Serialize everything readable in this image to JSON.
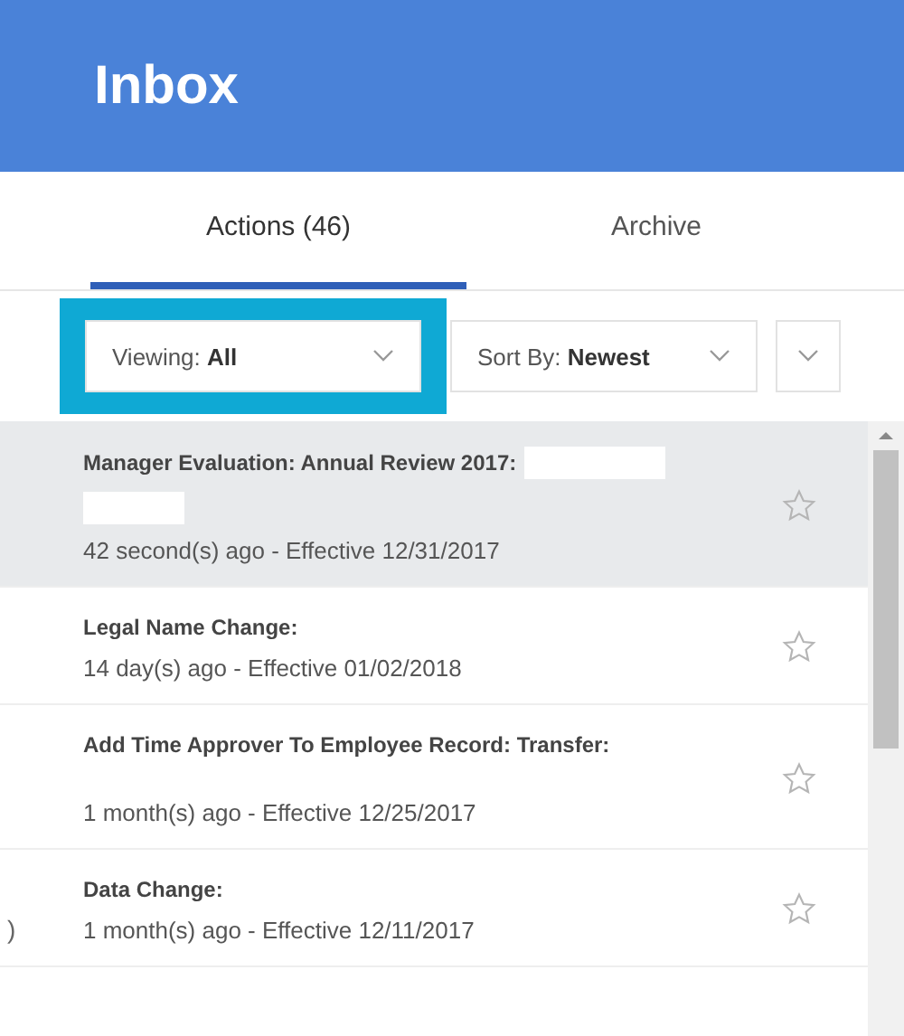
{
  "header": {
    "title": "Inbox"
  },
  "tabs": [
    {
      "label": "Actions (46)",
      "selected": true
    },
    {
      "label": "Archive",
      "selected": false
    }
  ],
  "filters": [
    {
      "label": "Viewing: **All**",
      "highlighted": true
    },
    {
      "label": "Sort By: **Newest**",
      "highlighted": false
    }
  ],
  "items": [
    {
      "title": "Manager Evaluation: Annual Review 2017:",
      "redacted": true,
      "meta": "42 second(s) ago - Effective 12/31/2017",
      "selected": true,
      "starred": false
    },
    {
      "title": "Legal Name Change:",
      "redacted": false,
      "meta": "14 day(s) ago - Effective 01/02/2018",
      "selected": false,
      "starred": false
    },
    {
      "title": "Add Time Approver To Employee Record: Transfer:",
      "redacted": false,
      "meta": "1 month(s) ago - Effective 12/25/2017",
      "selected": false,
      "starred": false,
      "tall": true
    },
    {
      "title": "Data Change:",
      "redacted": false,
      "meta": "1 month(s) ago - Effective 12/11/2017",
      "selected": false,
      "starred": false,
      "gutter_text": ")"
    }
  ]
}
